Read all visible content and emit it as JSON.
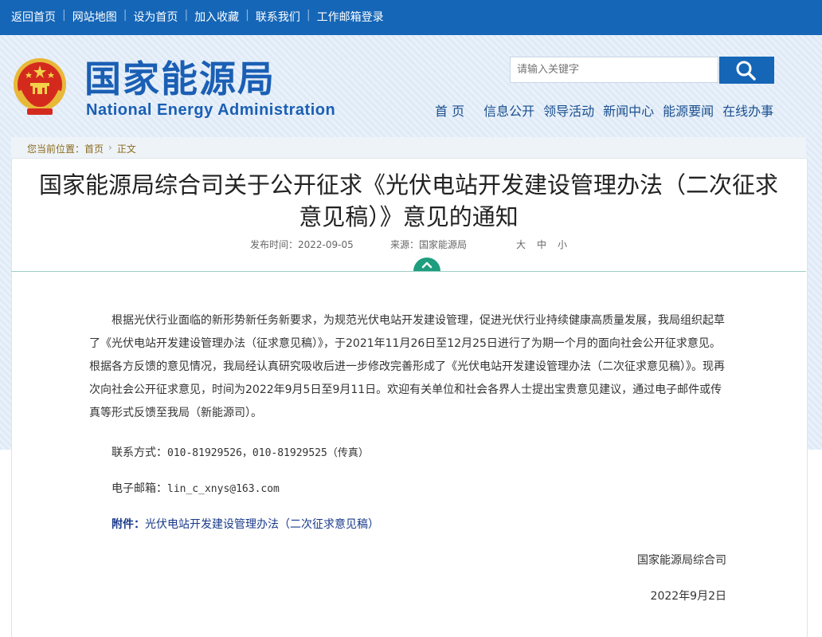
{
  "topbar": {
    "links": [
      "返回首页",
      "网站地图",
      "设为首页",
      "加入收藏",
      "联系我们",
      "工作邮箱登录"
    ],
    "separator": "|"
  },
  "header": {
    "logo_cn": "国家能源局",
    "logo_en": "National Energy Administration",
    "search_placeholder": "请输入关键字",
    "nav": [
      "首 页",
      "信息公开",
      "领导活动",
      "新闻中心",
      "能源要闻",
      "在线办事"
    ]
  },
  "breadcrumb": {
    "prefix": "您当前位置：",
    "items": [
      "首页",
      "正文"
    ]
  },
  "article": {
    "title_line1": "国家能源局综合司关于公开征求《光伏电站开发建设管理办法（二次征求",
    "title_line2": "意见稿）》意见的通知",
    "publish_time": "发布时间：2022-09-05",
    "source": "来源：国家能源局",
    "font_sizes": [
      "大",
      "中",
      "小"
    ],
    "paragraph": "根据光伏行业面临的新形势新任务新要求，为规范光伏电站开发建设管理，促进光伏行业持续健康高质量发展，我局组织起草了《光伏电站开发建设管理办法（征求意见稿）》，于2021年11月26日至12月25日进行了为期一个月的面向社会公开征求意见。根据各方反馈的意见情况，我局经认真研究吸收后进一步修改完善形成了《光伏电站开发建设管理办法（二次征求意见稿）》。现再次向社会公开征求意见，时间为2022年9月5日至9月11日。欢迎有关单位和社会各界人士提出宝贵意见建议，通过电子邮件或传真等形式反馈至我局（新能源司）。",
    "contact_label": "联系方式：",
    "contact_value": "010-81929526，010-81929525（传真）",
    "email_label": "电子邮箱：",
    "email_value": "lin_c_xnys@163.com",
    "attachment_label": "附件：",
    "attachment_link": "光伏电站开发建设管理办法（二次征求意见稿）",
    "signature": "国家能源局综合司",
    "date": "2022年9月2日"
  },
  "colors": {
    "topbar": "#1566b7",
    "logo": "#1a5fb4",
    "accent_green": "#1e9e7e"
  }
}
